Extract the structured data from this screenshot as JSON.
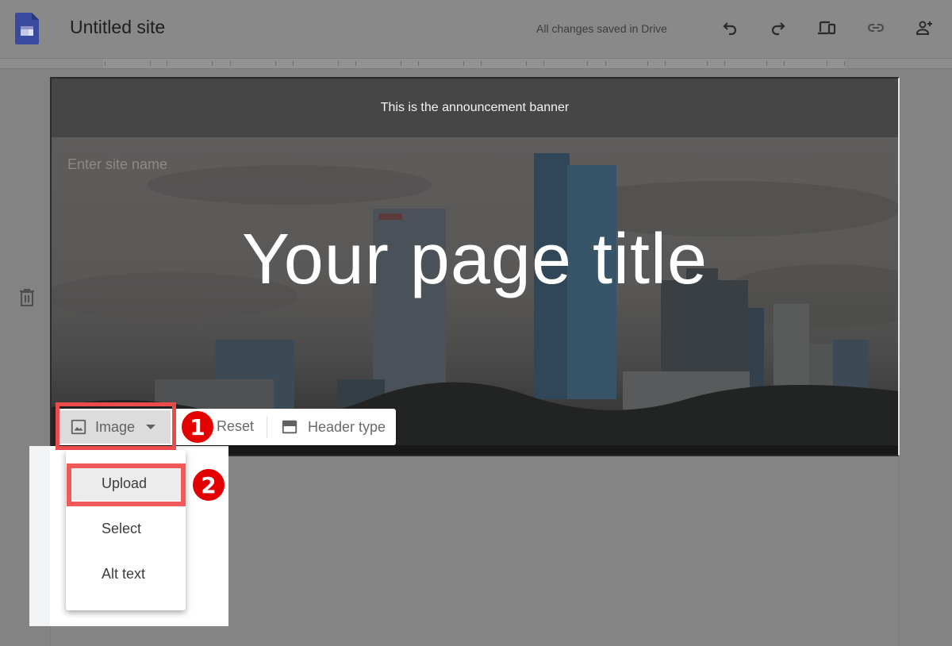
{
  "app": {
    "title": "Untitled site",
    "save_status": "All changes saved in Drive",
    "logo_color": "#3a4aa0"
  },
  "toolbar": {
    "buttons": [
      {
        "name": "undo",
        "icon": "undo-icon"
      },
      {
        "name": "redo",
        "icon": "redo-icon"
      },
      {
        "name": "preview",
        "icon": "devices-icon"
      },
      {
        "name": "copy-link",
        "icon": "link-icon"
      },
      {
        "name": "share",
        "icon": "add-person-icon"
      }
    ]
  },
  "sidebar": {
    "delete_icon": "trash-icon"
  },
  "header": {
    "announcement_banner": "This is the announcement banner",
    "site_name_placeholder": "Enter site name",
    "page_title": "Your page title"
  },
  "header_toolbar": {
    "image_label": "Image",
    "reset_label": "Reset",
    "header_type_label": "Header type"
  },
  "image_menu": {
    "items": [
      {
        "label": "Upload",
        "highlighted": true
      },
      {
        "label": "Select"
      },
      {
        "label": "Alt text"
      }
    ]
  },
  "annotations": {
    "step1": "1",
    "step2": "2",
    "highlight_color": "#ec4b4b",
    "badge_color": "#e20000"
  }
}
